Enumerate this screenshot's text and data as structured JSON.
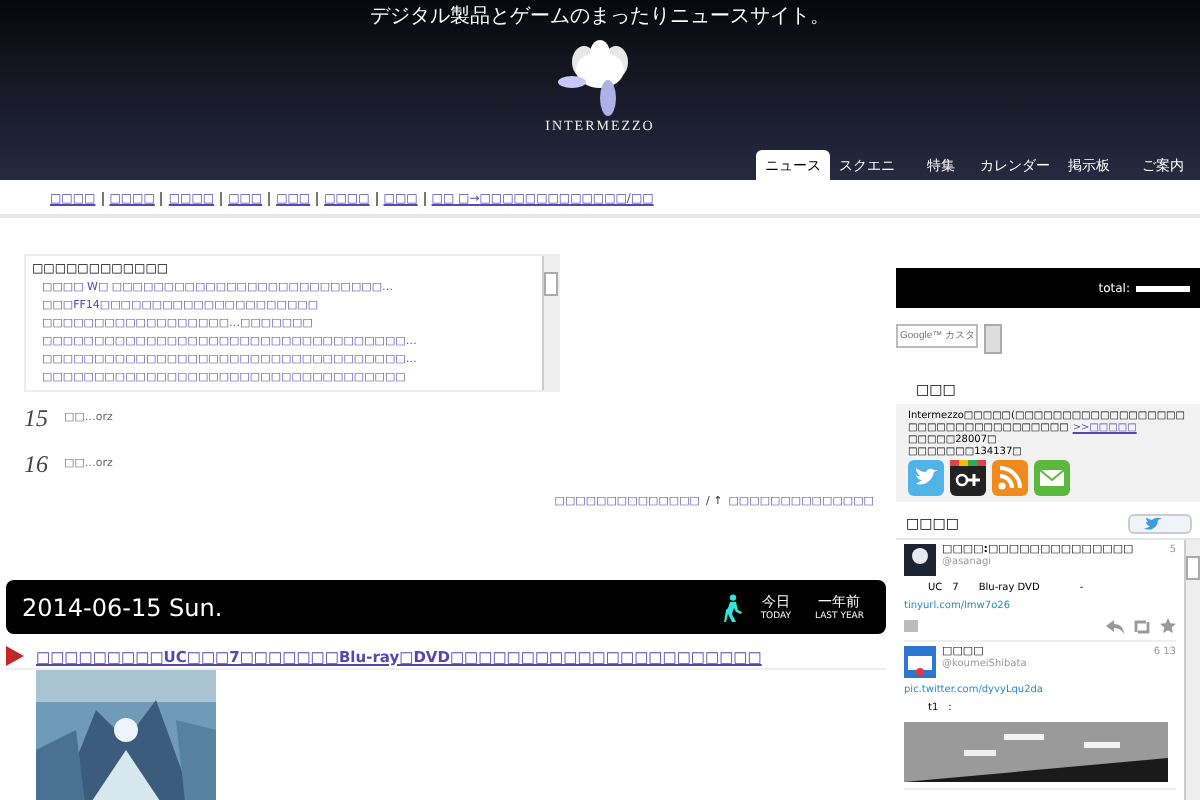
{
  "header": {
    "tagline": "デジタル製品とゲームのまったりニュースサイト。",
    "logo_text": "INTERMEZZO"
  },
  "tabs": [
    {
      "label": "ニュース",
      "selected": true
    },
    {
      "label": "スクエニ",
      "selected": false
    },
    {
      "label": "特集",
      "selected": false
    },
    {
      "label": "カレンダー",
      "selected": false
    },
    {
      "label": "掲示板",
      "selected": false
    },
    {
      "label": "ご案内",
      "selected": false
    }
  ],
  "nav_links": [
    "□□□□",
    "□□□□",
    "□□□□",
    "□□□",
    "□□□",
    "□□□□",
    "□□□",
    "□□ □→□□□□□□□□□□□□□/□□"
  ],
  "headlines": {
    "title": "□□□□□□□□□□□□",
    "items": [
      "□□□□ W□ □□□□□□□□□□□□□□□□□□□□□□□□□□…",
      "□□□FF14□□□□□□□□□□□□□□□□□□□□□",
      "□□□□□□□□□□□□□□□□□□…□□□□□□□",
      "□□□□□□□□□□□□□□□□□□□□□□□□□□□□□□□□□□□…",
      "□□□□□□□□□□□□□□□□□□□□□□□□□□□□□□□□□□□…",
      "□□□□□□□□□□□□□□□□□□□□□□□□□□□□□□□□□□□"
    ]
  },
  "comments": [
    {
      "day": "15",
      "text": "□□…orz"
    },
    {
      "day": "16",
      "text": "□□…orz"
    }
  ],
  "pager": {
    "prev": "□□□□□□□□□□□□□□",
    "separator": "/ ↑",
    "next": "□□□□□□□□□□□□□□"
  },
  "date_bar": {
    "date": "2014-06-15 Sun.",
    "buttons": [
      {
        "label": "今日",
        "sub": "TODAY"
      },
      {
        "label": "一年前",
        "sub": "LAST YEAR"
      }
    ]
  },
  "article": {
    "title": "□□□□□□□□□UC□□□7□□□□□□□Blu-ray□DVD□□□□□□□□□□□□□□□□□□□□□□"
  },
  "sidebar": {
    "counter_label": "total:",
    "search_placeholder": "Google™ カスタ",
    "about": {
      "heading": "□□□",
      "intro": "Intermezzo□□□□□(□□□□□□□□□□□□□□□□□□",
      "line": "□□□□□□□□□□□□□□□□□",
      "link": ">>□□□□□",
      "stats": [
        "□□□□□28007□",
        "□□□□□□□134137□"
      ]
    },
    "twitter": {
      "heading": "□□□□",
      "tweets": [
        {
          "name": "□□□□:□□□□□□□□□□□□□□",
          "handle": "@asanagi",
          "time": "5",
          "text": "UC　7　　Blu-ray DVD　　　　-",
          "link": "tinyurl.com/lmw7o26",
          "kind": "actions"
        },
        {
          "name": "□□□□",
          "handle": "@koumeiShibata",
          "time": "6 13",
          "link": "pic.twitter.com/dyvyLqu2da",
          "note": "t1　:"
        }
      ]
    }
  }
}
